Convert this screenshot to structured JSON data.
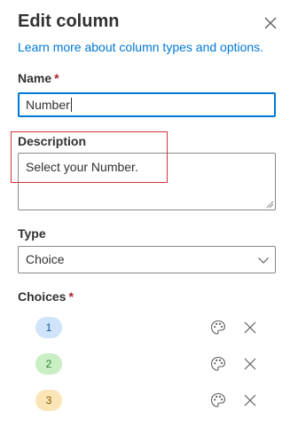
{
  "panel": {
    "title": "Edit column",
    "learn_more": "Learn more about column types and options.",
    "close_icon": "close-icon"
  },
  "name_field": {
    "label": "Name",
    "required_marker": "*",
    "value": "Number"
  },
  "description_field": {
    "label": "Description",
    "value": "Select your Number."
  },
  "type_field": {
    "label": "Type",
    "selected": "Choice",
    "icon": "chevron-down-icon"
  },
  "choices": {
    "label": "Choices",
    "required_marker": "*",
    "items": [
      {
        "label": "1",
        "bg": "#cfe4fa",
        "fg": "#0b5394",
        "palette_icon": "palette-icon",
        "remove_icon": "close-icon"
      },
      {
        "label": "2",
        "bg": "#caefc5",
        "fg": "#2e7d32",
        "palette_icon": "palette-icon",
        "remove_icon": "close-icon"
      },
      {
        "label": "3",
        "bg": "#fbe5b6",
        "fg": "#8a5a00",
        "palette_icon": "palette-icon",
        "remove_icon": "close-icon"
      }
    ]
  },
  "colors": {
    "accent": "#0078d4",
    "required": "#a4262c",
    "highlight": "#d13438"
  }
}
